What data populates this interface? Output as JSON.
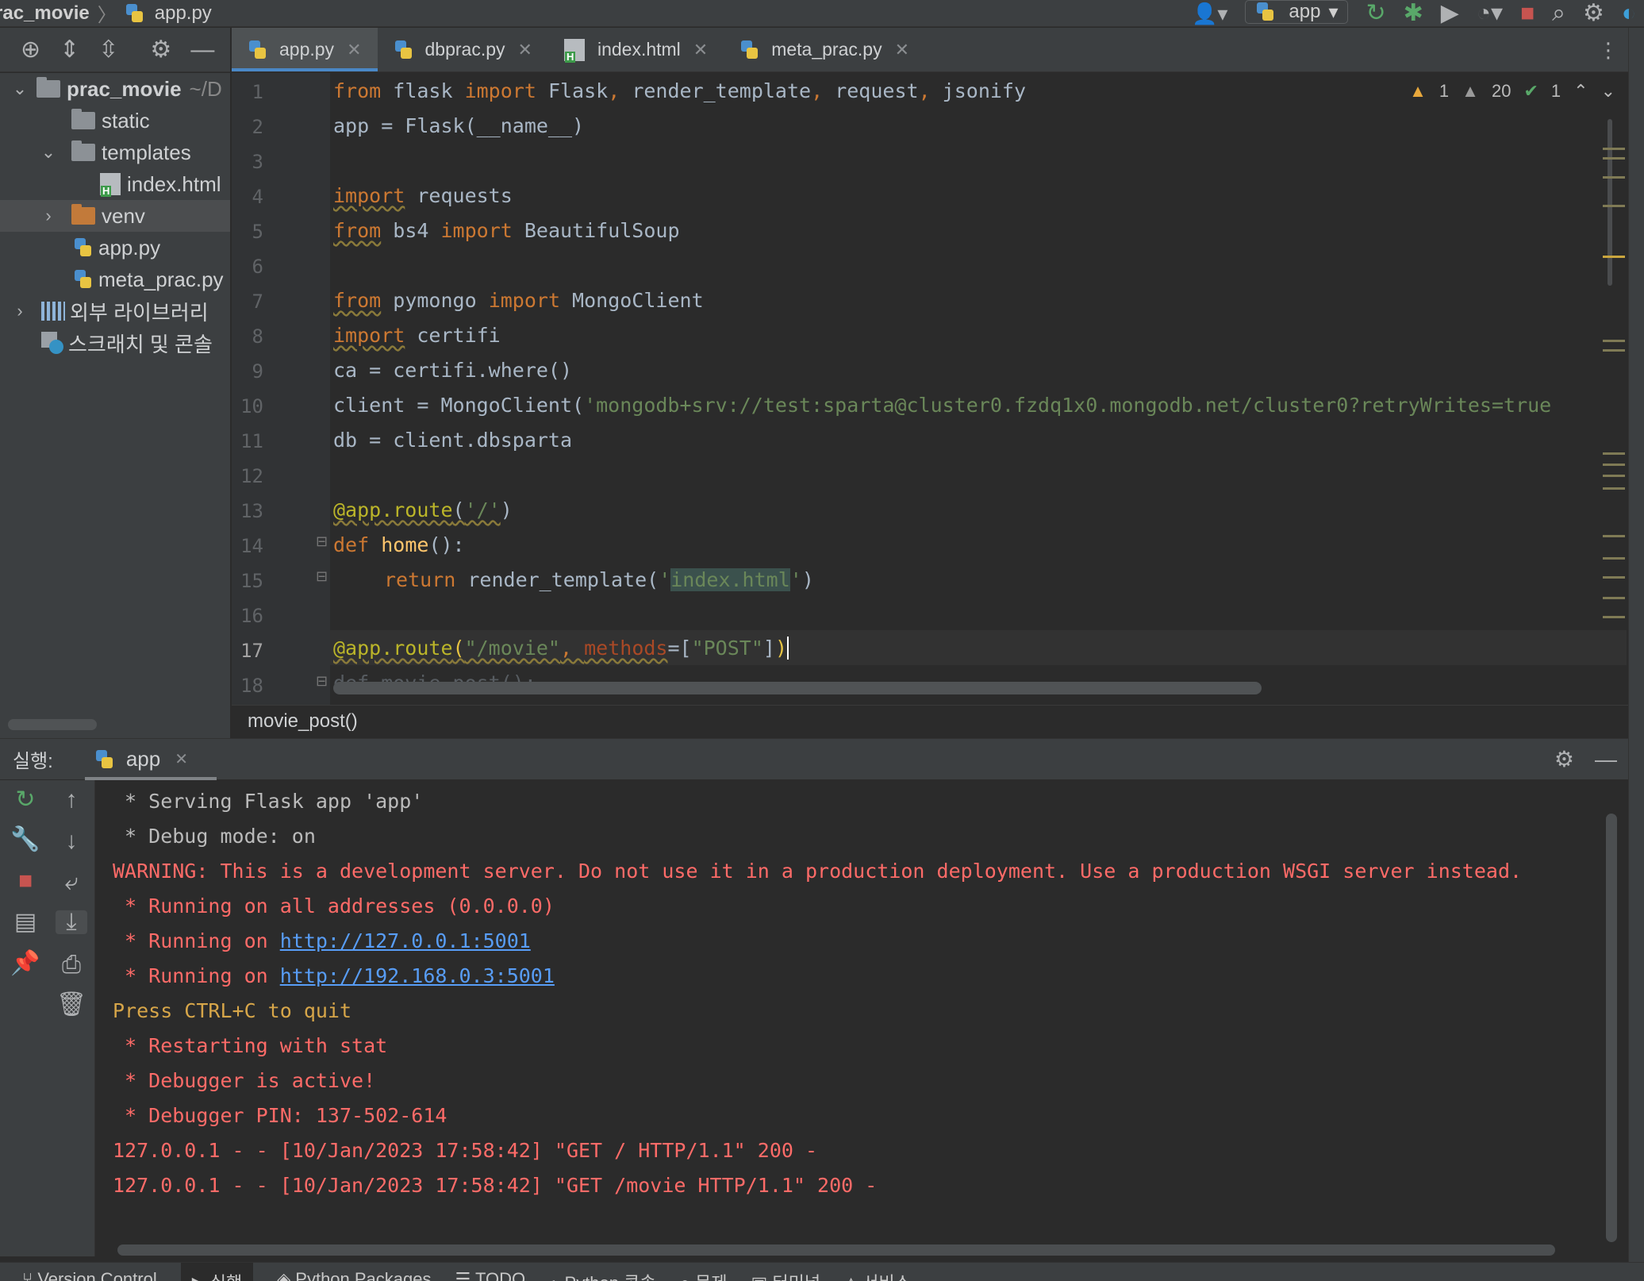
{
  "navbar": {
    "project": "rac_movie",
    "file": "app.py",
    "run_config": "app"
  },
  "project_tree": {
    "items": [
      {
        "label": "prac_movie",
        "hint": "~/D"
      },
      {
        "label": "static"
      },
      {
        "label": "templates"
      },
      {
        "label": "index.html"
      },
      {
        "label": "venv"
      },
      {
        "label": "app.py"
      },
      {
        "label": "meta_prac.py"
      },
      {
        "label": "외부 라이브러리"
      },
      {
        "label": "스크래치 및 콘솔"
      }
    ]
  },
  "tabs": [
    {
      "label": "app.py"
    },
    {
      "label": "dbprac.py"
    },
    {
      "label": "index.html"
    },
    {
      "label": "meta_prac.py"
    }
  ],
  "inspections": {
    "warnings": "1",
    "weak_warnings": "20",
    "typos": "1"
  },
  "editor": {
    "line_numbers": [
      "1",
      "2",
      "3",
      "4",
      "5",
      "6",
      "7",
      "8",
      "9",
      "10",
      "11",
      "12",
      "13",
      "14",
      "15",
      "16",
      "17",
      "18"
    ],
    "lines": {
      "l1": {
        "a": "from",
        "b": " flask ",
        "c": "import",
        "d": " Flask",
        "e": ", ",
        "f": "render_template",
        "g": ", ",
        "h": "request",
        "i": ", ",
        "j": "jsonify"
      },
      "l2": "app = Flask(__name__)",
      "l4": {
        "a": "import",
        "b": " requests"
      },
      "l5": {
        "a": "from",
        "b": " bs4 ",
        "c": "import",
        "d": " BeautifulSoup"
      },
      "l7": {
        "a": "from",
        "b": " pymongo ",
        "c": "import",
        "d": " MongoClient"
      },
      "l8": {
        "a": "import",
        "b": " certifi"
      },
      "l9": "ca = certifi.where()",
      "l10": {
        "a": "client = MongoClient(",
        "b": "'mongodb+srv://test:sparta@cluster0.fzdq1x0.mongodb.net/cluster0?retryWrites=true"
      },
      "l11": "db = client.dbsparta",
      "l13": {
        "a": "@app.route",
        "b": "(",
        "c": "'/'",
        "d": ")"
      },
      "l14": {
        "a": "def",
        "b": " ",
        "c": "home",
        "d": "():"
      },
      "l15": {
        "a": "return",
        "b": " render_template(",
        "c": "'",
        "d": "index.html",
        "e": "'",
        "f": ")"
      },
      "l17": {
        "a": "@app.route",
        "b": "(",
        "c": "\"/movie\"",
        "d": ", ",
        "e": "methods",
        "f": "=[",
        "g": "\"POST\"",
        "h": "]",
        "i": ")"
      },
      "l18": "def movie_post():"
    }
  },
  "breadcrumb": "movie_post()",
  "run_panel": {
    "label": "실행:",
    "tab": "app",
    "console": [
      " * Serving Flask app 'app'",
      " * Debug mode: on",
      "WARNING: This is a development server. Do not use it in a production deployment. Use a production WSGI server instead.",
      " * Running on all addresses (0.0.0.0)",
      " * Running on ",
      "http://127.0.0.1:5001",
      " * Running on ",
      "http://192.168.0.3:5001",
      "Press CTRL+C to quit",
      " * Restarting with stat",
      " * Debugger is active!",
      " * Debugger PIN: 137-502-614",
      "127.0.0.1 - - [10/Jan/2023 17:58:42] \"GET / HTTP/1.1\" 200 -",
      "127.0.0.1 - - [10/Jan/2023 17:58:42] \"GET /movie HTTP/1.1\" 200 -"
    ]
  },
  "statusbar": {
    "items": [
      "Version Control",
      "실행",
      "Python Packages",
      "TODO",
      "Python 콘솔",
      "문제",
      "터미널",
      "서비스"
    ]
  },
  "colors": {
    "accent": "#4a88c7",
    "error": "#ff6b68",
    "link": "#589df6",
    "keyword": "#cc7832",
    "string": "#6a8759"
  }
}
